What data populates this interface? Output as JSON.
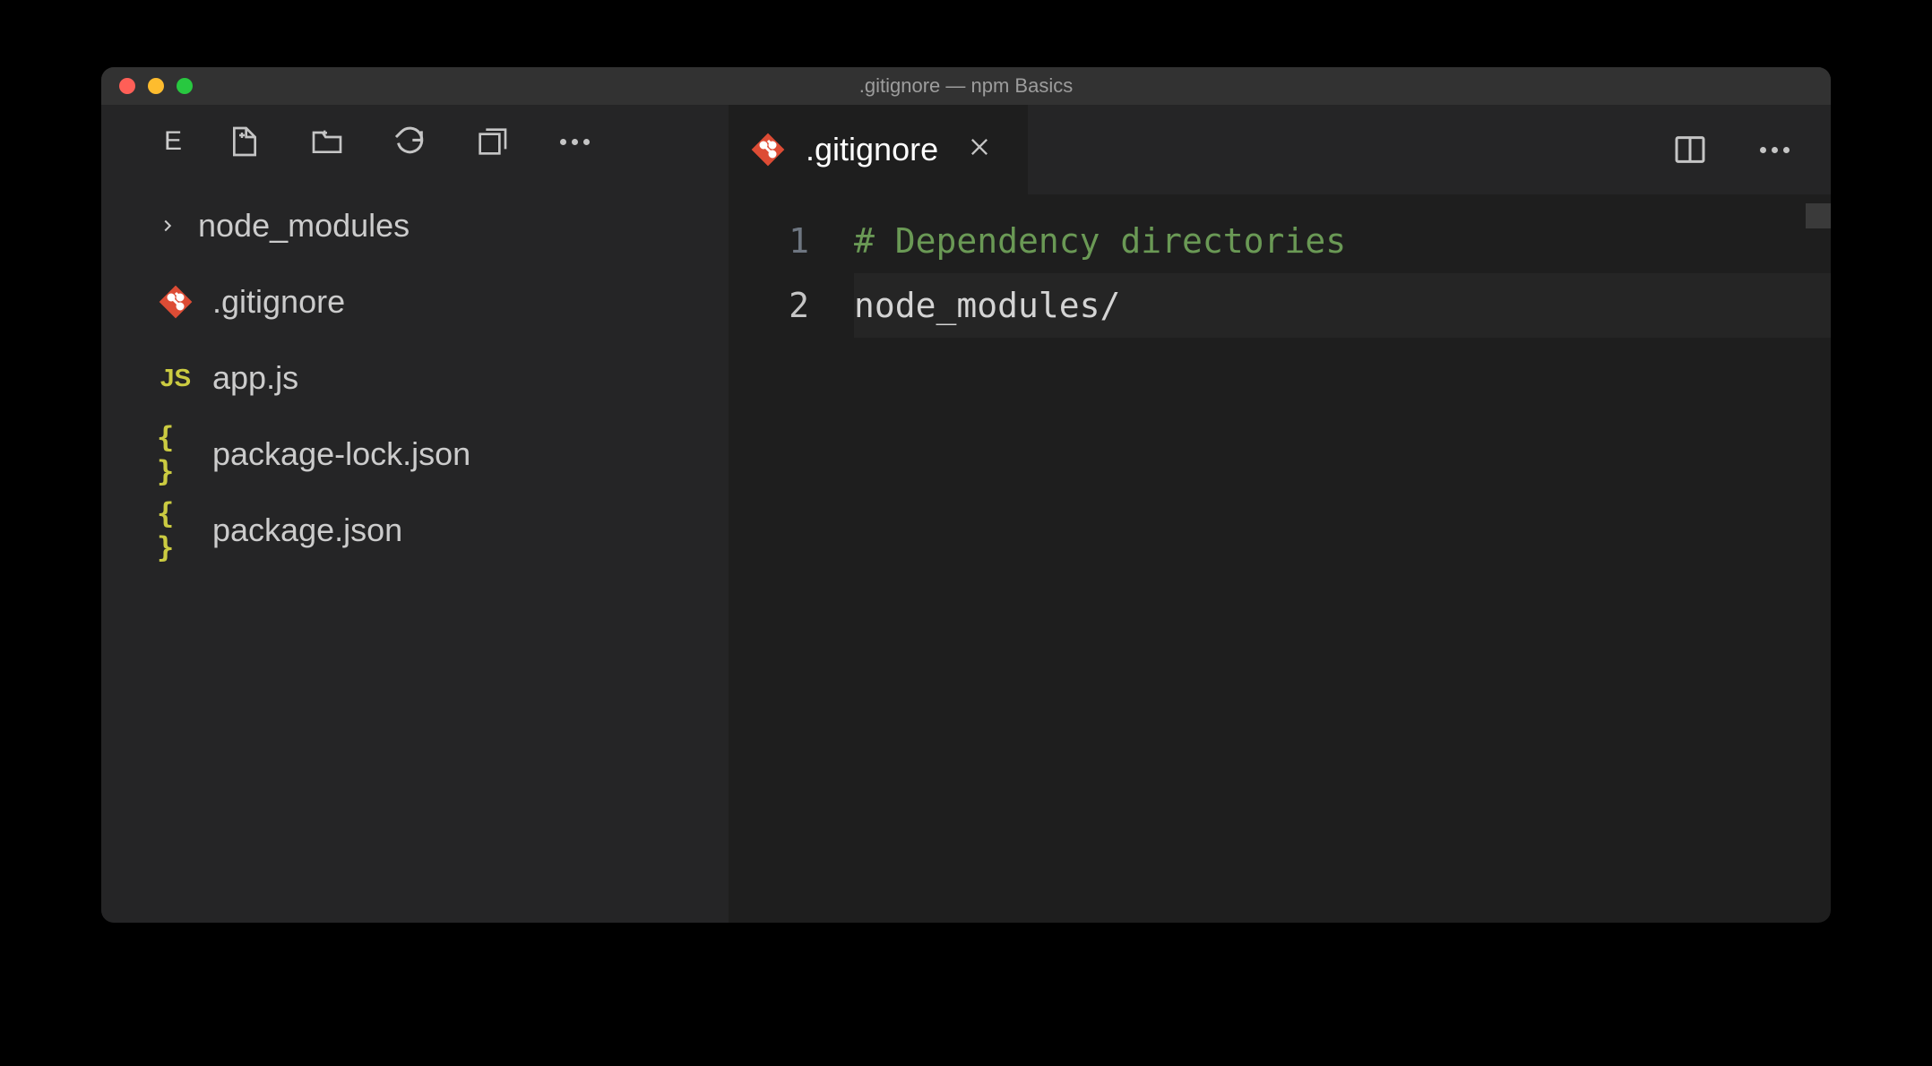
{
  "titlebar": {
    "title": ".gitignore — npm Basics"
  },
  "sidebar": {
    "section_label": "E",
    "items": [
      {
        "name": "node_modules",
        "type": "folder"
      },
      {
        "name": ".gitignore",
        "type": "git"
      },
      {
        "name": "app.js",
        "type": "js"
      },
      {
        "name": "package-lock.json",
        "type": "json"
      },
      {
        "name": "package.json",
        "type": "json"
      }
    ]
  },
  "tab": {
    "label": ".gitignore"
  },
  "editor": {
    "lines": [
      {
        "n": "1",
        "text": "# Dependency directories",
        "cls": "comment"
      },
      {
        "n": "2",
        "text": "node_modules/",
        "cls": "plain",
        "active": true
      }
    ]
  }
}
